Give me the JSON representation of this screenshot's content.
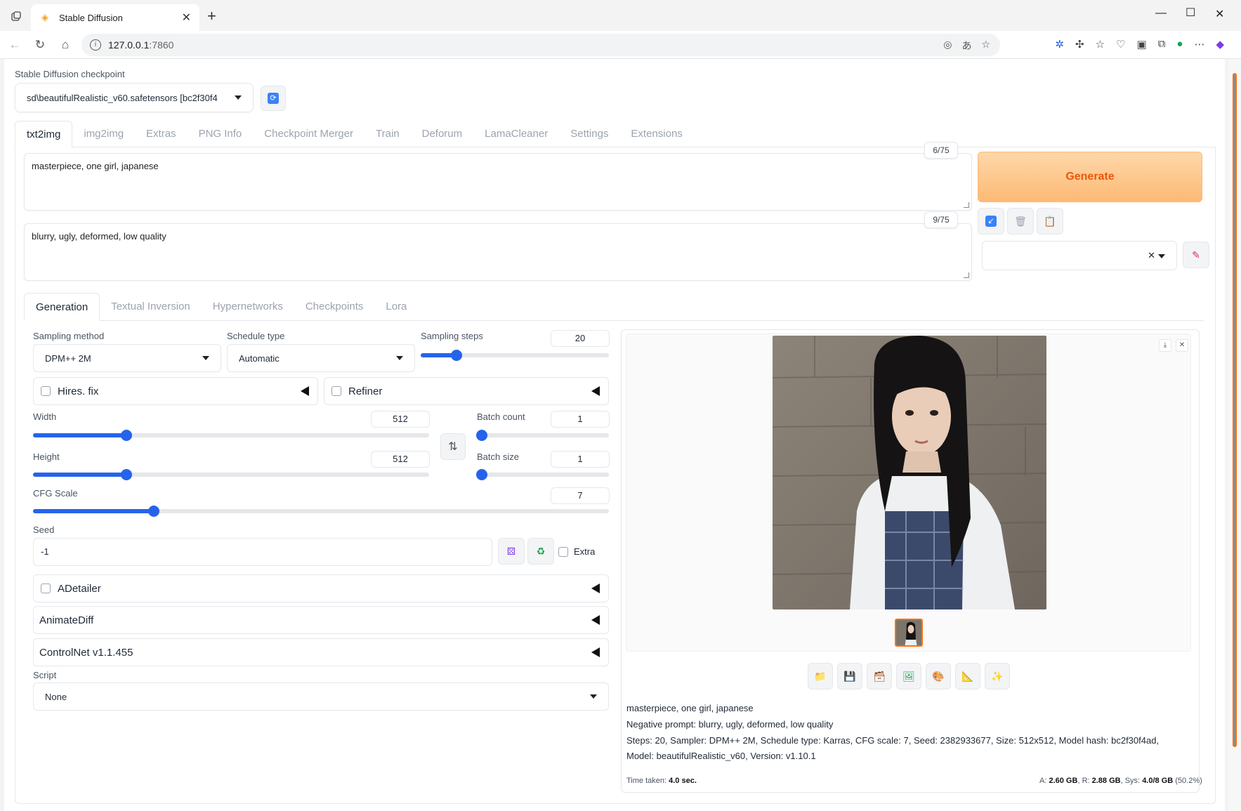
{
  "browser": {
    "tab_title": "Stable Diffusion",
    "url_host": "127.0.0.1",
    "url_port": ":7860"
  },
  "checkpoint": {
    "label": "Stable Diffusion checkpoint",
    "value": "sd\\beautifulRealistic_v60.safetensors [bc2f30f4"
  },
  "main_tabs": [
    "txt2img",
    "img2img",
    "Extras",
    "PNG Info",
    "Checkpoint Merger",
    "Train",
    "Deforum",
    "LamaCleaner",
    "Settings",
    "Extensions"
  ],
  "prompt": {
    "positive": "masterpiece, one girl, japanese",
    "positive_tokens": "6/75",
    "negative": "blurry, ugly, deformed, low quality",
    "negative_tokens": "9/75"
  },
  "generate_label": "Generate",
  "sub_tabs": [
    "Generation",
    "Textual Inversion",
    "Hypernetworks",
    "Checkpoints",
    "Lora"
  ],
  "generation": {
    "sampling_method_label": "Sampling method",
    "sampling_method": "DPM++ 2M",
    "schedule_type_label": "Schedule type",
    "schedule_type": "Automatic",
    "sampling_steps_label": "Sampling steps",
    "sampling_steps": "20",
    "hires_label": "Hires. fix",
    "refiner_label": "Refiner",
    "width_label": "Width",
    "width": "512",
    "height_label": "Height",
    "height": "512",
    "batch_count_label": "Batch count",
    "batch_count": "1",
    "batch_size_label": "Batch size",
    "batch_size": "1",
    "cfg_label": "CFG Scale",
    "cfg": "7",
    "seed_label": "Seed",
    "seed": "-1",
    "extra_label": "Extra",
    "adetailer_label": "ADetailer",
    "animatediff_label": "AnimateDiff",
    "controlnet_label": "ControlNet v1.1.455",
    "script_label": "Script",
    "script_value": "None"
  },
  "slider_levels": {
    "sampling_steps": 0.19,
    "width": 0.236,
    "height": 0.236,
    "batch_count": 0.0,
    "batch_size": 0.0,
    "cfg": 0.21
  },
  "output": {
    "line1": "masterpiece, one girl, japanese",
    "line2": "Negative prompt: blurry, ugly, deformed, low quality",
    "line3": "Steps: 20, Sampler: DPM++ 2M, Schedule type: Karras, CFG scale: 7, Seed: 2382933677, Size: 512x512, Model hash: bc2f30f4ad, Model: beautifulRealistic_v60, Version: v1.10.1",
    "time_label": "Time taken:",
    "time_value": "4.0 sec.",
    "mem_a_label": "A:",
    "mem_a": "2.60 GB",
    "mem_r_label": "R:",
    "mem_r": "2.88 GB",
    "mem_sys_label": "Sys:",
    "mem_sys": "4.0/8 GB",
    "mem_pct": "(50.2%)"
  }
}
